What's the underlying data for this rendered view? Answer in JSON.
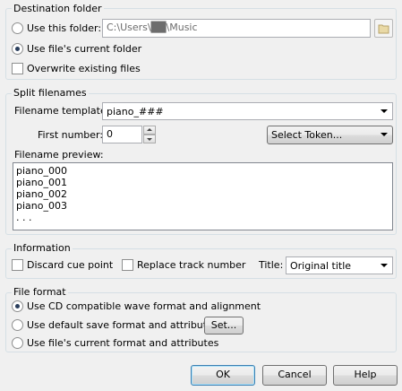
{
  "destination": {
    "legend": "Destination folder",
    "use_this_folder_label": "Use this folder:",
    "folder_path": "C:\\Users\\██\\Music",
    "use_current_folder_label": "Use file's current folder",
    "overwrite_label": "Overwrite existing files"
  },
  "split": {
    "legend": "Split filenames",
    "template_label": "Filename template:",
    "template_value": "piano_###",
    "first_number_label": "First number:",
    "first_number_value": "0",
    "select_token_label": "Select Token...",
    "preview_label": "Filename preview:",
    "preview_lines": [
      "piano_000",
      "piano_001",
      "piano_002",
      "piano_003",
      ". . ."
    ]
  },
  "information": {
    "legend": "Information",
    "discard_cue_label": "Discard cue point",
    "replace_track_label": "Replace track number",
    "title_label": "Title:",
    "title_value": "Original title"
  },
  "file_format": {
    "legend": "File format",
    "option_cd_label": "Use CD compatible wave format and alignment",
    "option_default_label": "Use default save format and attributes",
    "set_button_label": "Set...",
    "option_current_label": "Use file's current format and attributes"
  },
  "buttons": {
    "ok": "OK",
    "cancel": "Cancel",
    "help": "Help"
  }
}
